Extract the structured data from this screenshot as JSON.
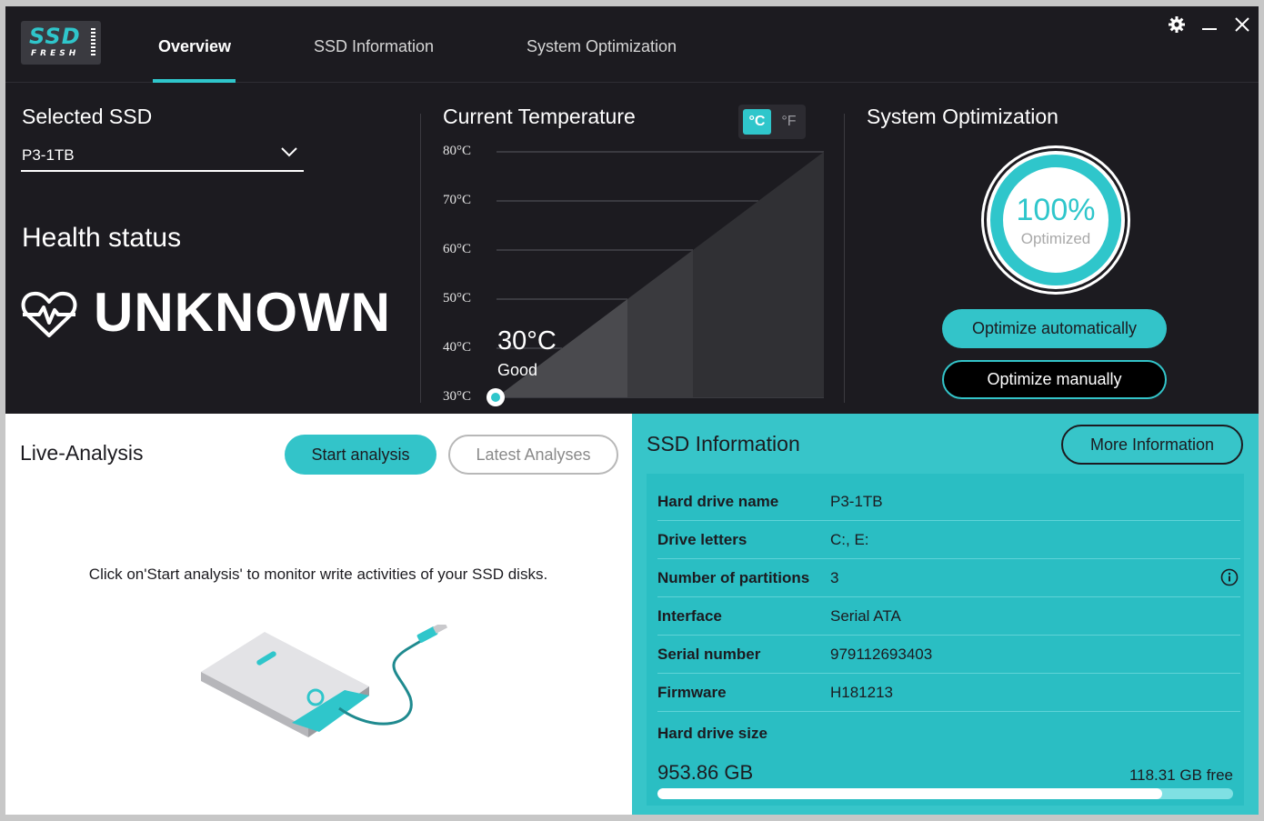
{
  "app": {
    "logo_main": "SSD",
    "logo_sub": "FRESH",
    "tabs": [
      "Overview",
      "SSD Information",
      "System Optimization"
    ],
    "active_tab": "Overview",
    "window_controls": [
      "gear-icon",
      "minimize-icon",
      "close-icon"
    ],
    "accent_color": "#2fc6cb"
  },
  "selected_ssd": {
    "label": "Selected SSD",
    "value": "P3-1TB"
  },
  "health": {
    "label": "Health status",
    "value": "UNKNOWN"
  },
  "temperature": {
    "title": "Current Temperature",
    "unit_c": "°C",
    "unit_f": "°F",
    "active_unit": "°C",
    "ticks": [
      "80°C",
      "70°C",
      "60°C",
      "50°C",
      "40°C",
      "30°C"
    ],
    "current": "30°C",
    "status": "Good",
    "current_value": 30
  },
  "optimization": {
    "title": "System Optimization",
    "percent": "100%",
    "percent_value": 100,
    "percent_label": "Optimized",
    "auto_button": "Optimize automatically",
    "manual_button": "Optimize manually"
  },
  "live_analysis": {
    "title": "Live-Analysis",
    "start_button": "Start analysis",
    "latest_button": "Latest Analyses",
    "message": "Click on'Start analysis' to monitor write activities of your SSD disks."
  },
  "ssd_info": {
    "title": "SSD Information",
    "more_button": "More Information",
    "rows": [
      {
        "label": "Hard drive name",
        "value": "P3-1TB"
      },
      {
        "label": "Drive letters",
        "value": "C:, E:"
      },
      {
        "label": "Number of partitions",
        "value": "3"
      },
      {
        "label": "Interface",
        "value": "Serial ATA"
      },
      {
        "label": "Serial number",
        "value": "979112693403"
      },
      {
        "label": "Firmware",
        "value": "H181213"
      }
    ],
    "size_label": "Hard drive size",
    "size_value": "953.86 GB",
    "free_value": "118.31 GB free",
    "used_fraction": 0.876
  }
}
